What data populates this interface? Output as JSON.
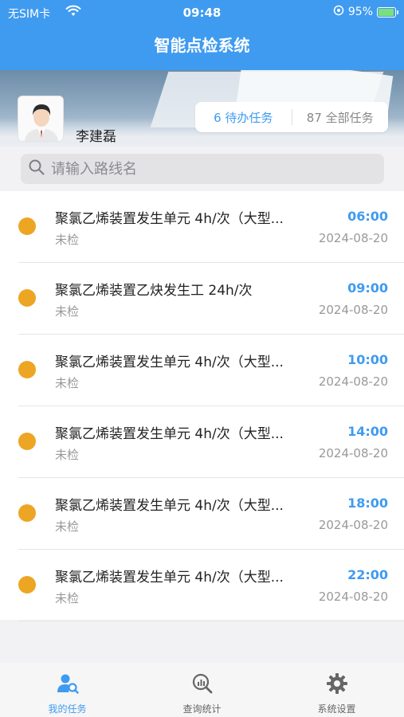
{
  "statusbar": {
    "carrier": "无SIM卡",
    "time": "09:48",
    "battery": "95%",
    "battery_level": 0.95
  },
  "header": {
    "title": "智能点检系统"
  },
  "user": {
    "name": "李建磊"
  },
  "tasks_summary": {
    "pending_count": "6",
    "pending_label": "待办任务",
    "all_count": "87",
    "all_label": "全部任务"
  },
  "search": {
    "placeholder": "请输入路线名",
    "value": ""
  },
  "tasks": [
    {
      "title": "聚氯乙烯装置发生单元 4h/次（大型...",
      "status": "未检",
      "time": "06:00",
      "date": "2024-08-20"
    },
    {
      "title": "聚氯乙烯装置乙炔发生工 24h/次",
      "status": "未检",
      "time": "09:00",
      "date": "2024-08-20"
    },
    {
      "title": "聚氯乙烯装置发生单元 4h/次（大型...",
      "status": "未检",
      "time": "10:00",
      "date": "2024-08-20"
    },
    {
      "title": "聚氯乙烯装置发生单元 4h/次（大型...",
      "status": "未检",
      "time": "14:00",
      "date": "2024-08-20"
    },
    {
      "title": "聚氯乙烯装置发生单元 4h/次（大型...",
      "status": "未检",
      "time": "18:00",
      "date": "2024-08-20"
    },
    {
      "title": "聚氯乙烯装置发生单元 4h/次（大型...",
      "status": "未检",
      "time": "22:00",
      "date": "2024-08-20"
    }
  ],
  "tabbar": {
    "items": [
      {
        "label": "我的任务",
        "icon": "user-task-icon",
        "active": true
      },
      {
        "label": "查询统计",
        "icon": "search-stats-icon",
        "active": false
      },
      {
        "label": "系统设置",
        "icon": "gear-icon",
        "active": false
      }
    ]
  },
  "colors": {
    "accent": "#3f9bf0",
    "status_dot": "#eda524"
  }
}
